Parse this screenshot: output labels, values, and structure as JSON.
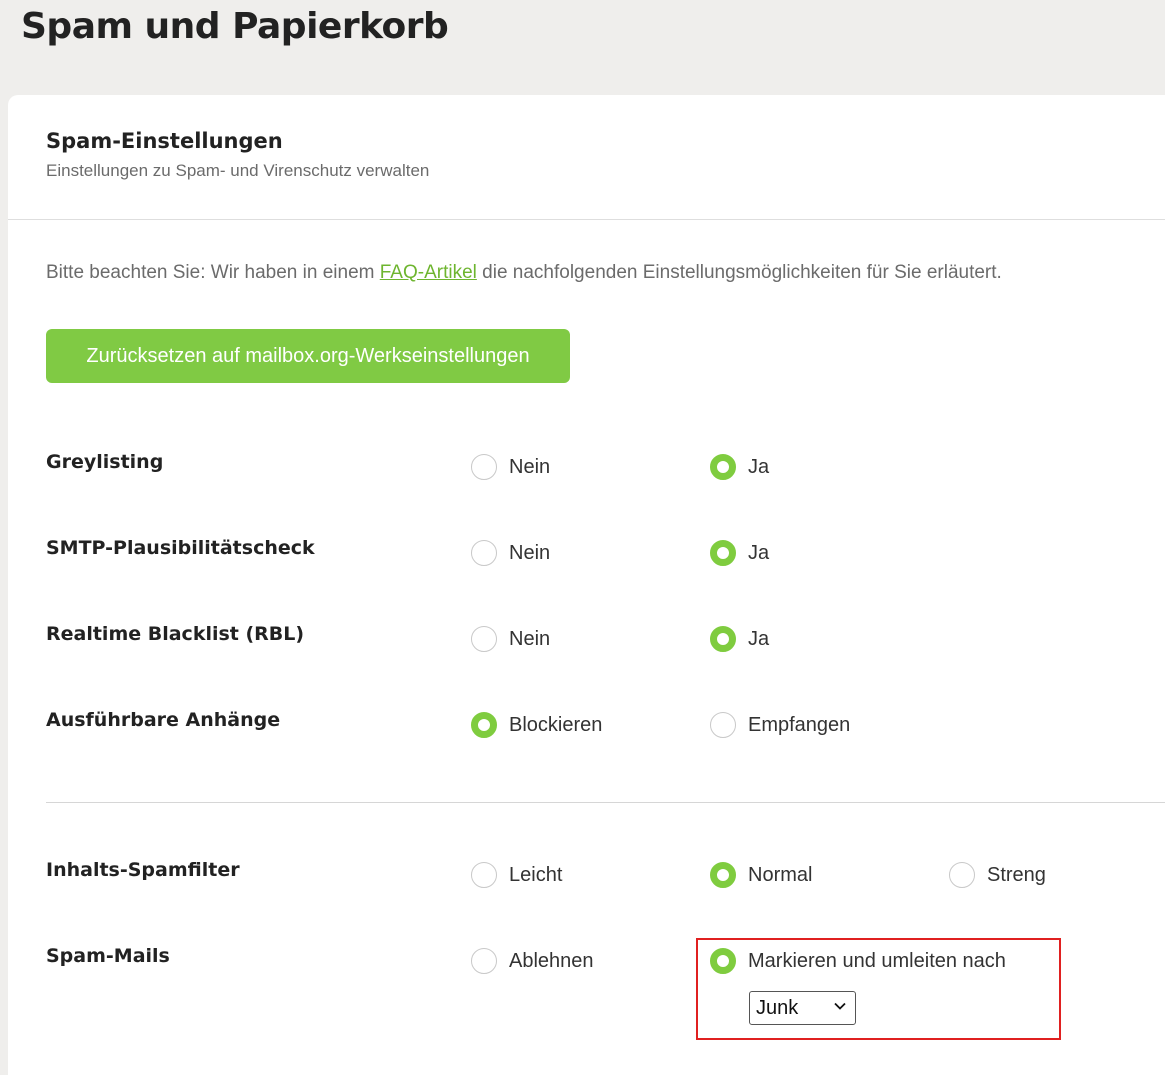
{
  "page": {
    "title": "Spam und Papierkorb"
  },
  "card": {
    "title": "Spam-Einstellungen",
    "subtitle": "Einstellungen zu Spam- und Virenschutz verwalten",
    "notice_before": "Bitte beachten Sie: Wir haben in einem ",
    "notice_link": "FAQ-Artikel",
    "notice_after": " die nachfolgenden Einstellungsmöglichkeiten für Sie erläutert.",
    "reset_button": "Zurücksetzen auf mailbox.org-Werkseinstellungen"
  },
  "settings": [
    {
      "label": "Greylisting",
      "options": [
        "Nein",
        "Ja"
      ],
      "selected": "Ja"
    },
    {
      "label": "SMTP-Plausibilitätscheck",
      "options": [
        "Nein",
        "Ja"
      ],
      "selected": "Ja"
    },
    {
      "label": "Realtime Blacklist (RBL)",
      "options": [
        "Nein",
        "Ja"
      ],
      "selected": "Ja"
    },
    {
      "label": "Ausführbare Anhänge",
      "options": [
        "Blockieren",
        "Empfangen"
      ],
      "selected": "Blockieren"
    },
    {
      "label": "Inhalts-Spamfilter",
      "options": [
        "Leicht",
        "Normal",
        "Streng"
      ],
      "selected": "Normal"
    },
    {
      "label": "Spam-Mails",
      "options": [
        "Ablehnen",
        "Markieren und umleiten nach"
      ],
      "selected": "Markieren und umleiten nach"
    }
  ],
  "spam_folder_select": {
    "value": "Junk"
  },
  "colors": {
    "accent": "#80ca44",
    "radio_checked": "#7fcc3f",
    "highlight": "#e02020",
    "link": "#6eb52f"
  }
}
